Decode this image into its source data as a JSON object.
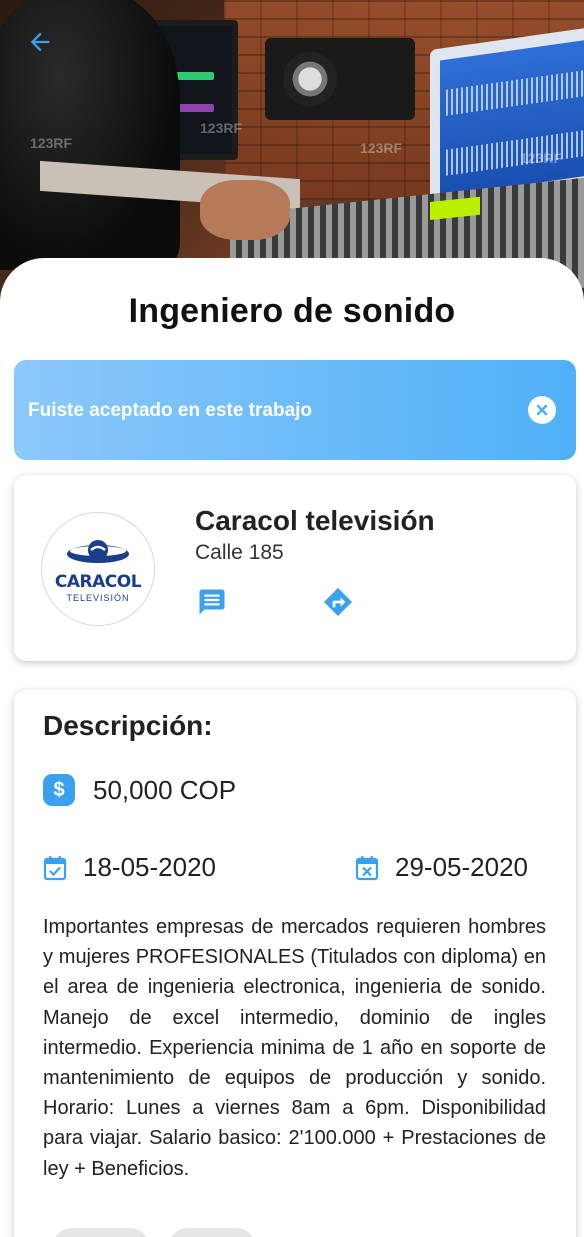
{
  "header": {
    "back_icon": "arrow-back-icon",
    "watermarks": [
      "123RF",
      "123RF",
      "123RF",
      "123RF"
    ]
  },
  "job": {
    "title": "Ingeniero de sonido"
  },
  "status_banner": {
    "message": "Fuiste aceptado en este trabajo",
    "close_icon": "close-circle-icon",
    "colors": {
      "start": "#8cc8fb",
      "end": "#4fb0f7"
    }
  },
  "company": {
    "name": "Caracol televisión",
    "address": "Calle 185",
    "logo_text": "CARACOL",
    "logo_subtext": "TELEVISIÓN",
    "chat_icon": "chat-icon",
    "directions_icon": "directions-icon"
  },
  "description": {
    "heading": "Descripción:",
    "salary": "50,000 COP",
    "salary_icon": "dollar-icon",
    "start_date": "18-05-2020",
    "start_icon": "calendar-check-icon",
    "end_date": "29-05-2020",
    "end_icon": "calendar-x-icon",
    "body": "Importantes empresas de mercados requieren hombres y mujeres PROFESIONALES (Titulados con diploma) en el area de ingenieria electronica, ingenieria de sonido. Manejo de excel intermedio, dominio de ingles intermedio. Experiencia minima de 1 año en soporte de mantenimiento de equipos de producción y sonido. Horario: Lunes a viernes 8am a 6pm. Disponibilidad para viajar. Salario basico: 2'100.000 + Prestaciones de ley + Beneficios."
  },
  "theme": {
    "accent": "#3aa0f0",
    "logo_blue": "#1a3e8c"
  }
}
